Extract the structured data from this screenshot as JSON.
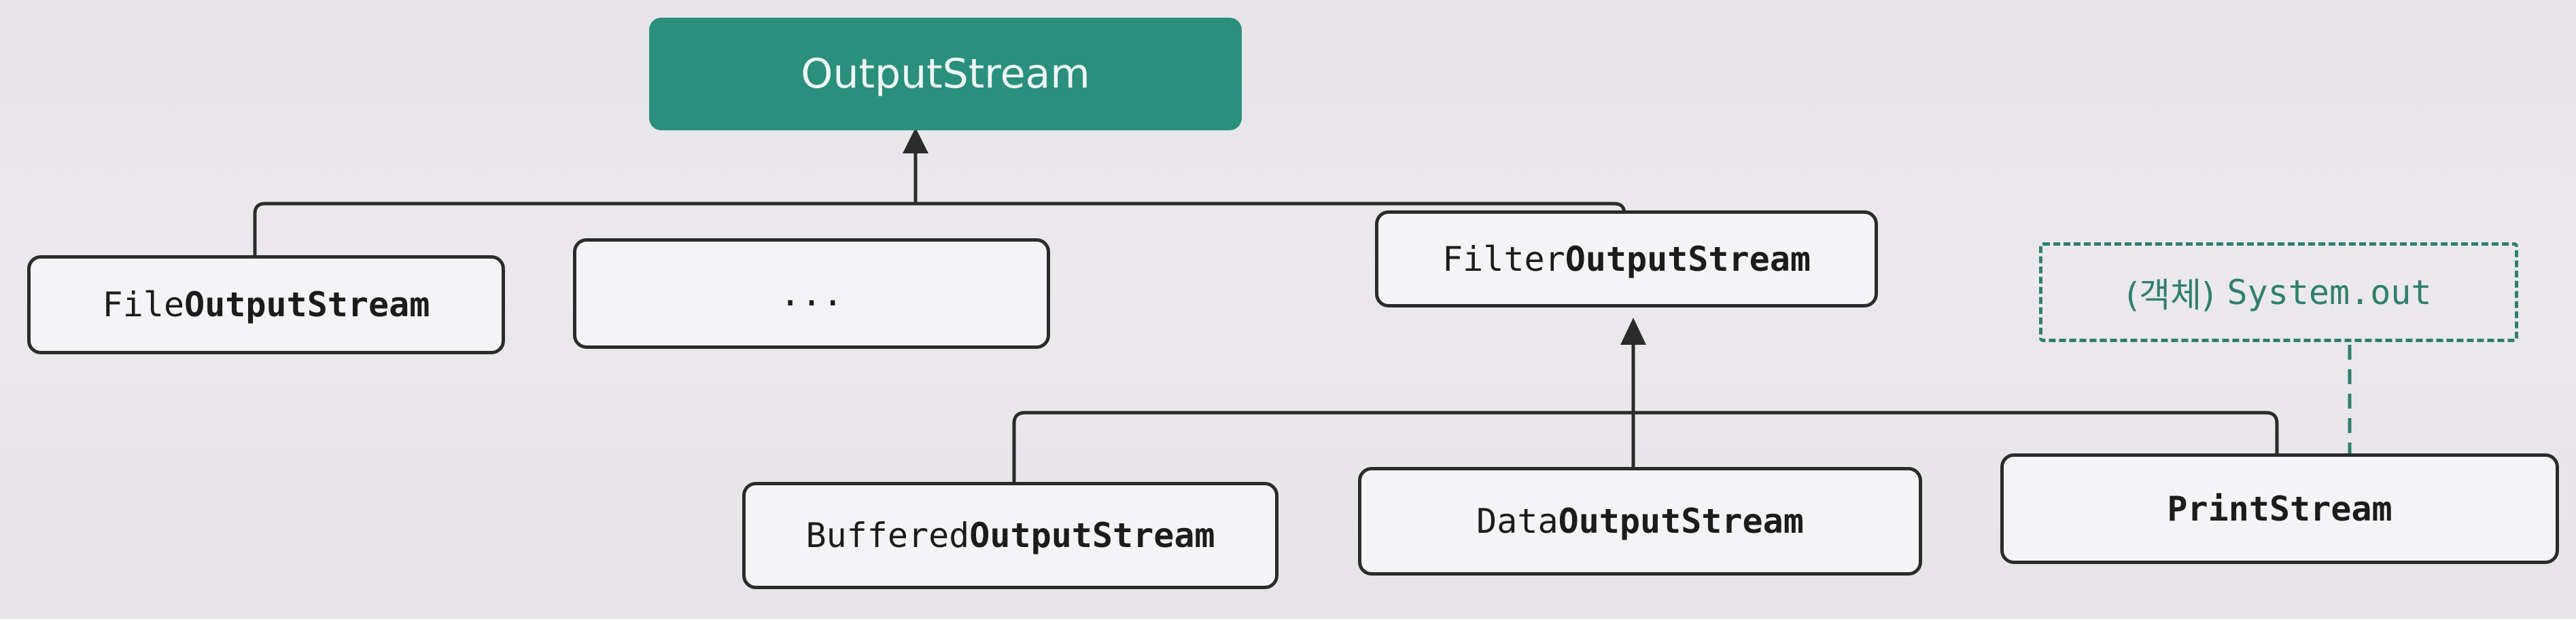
{
  "diagram": {
    "root": {
      "label": "OutputStream"
    },
    "level1": [
      {
        "id": "file",
        "prefix": "File",
        "bold": "OutputStream"
      },
      {
        "id": "etc",
        "label": "..."
      },
      {
        "id": "filter",
        "prefix": "Filter",
        "bold": "OutputStream"
      }
    ],
    "level2": [
      {
        "id": "buffered",
        "prefix": "Buffered",
        "bold": "OutputStream"
      },
      {
        "id": "data",
        "prefix": "Data",
        "bold": "OutputStream"
      },
      {
        "id": "print",
        "prefix": "",
        "bold": "PrintStream"
      }
    ],
    "instance": {
      "korean": "(객체)",
      "label": "System.out"
    },
    "colors": {
      "accent": "#2a8f7c",
      "dashed": "#2f7f6e",
      "line": "#2b2b2b",
      "box_fill": "#f4f3f5"
    }
  }
}
